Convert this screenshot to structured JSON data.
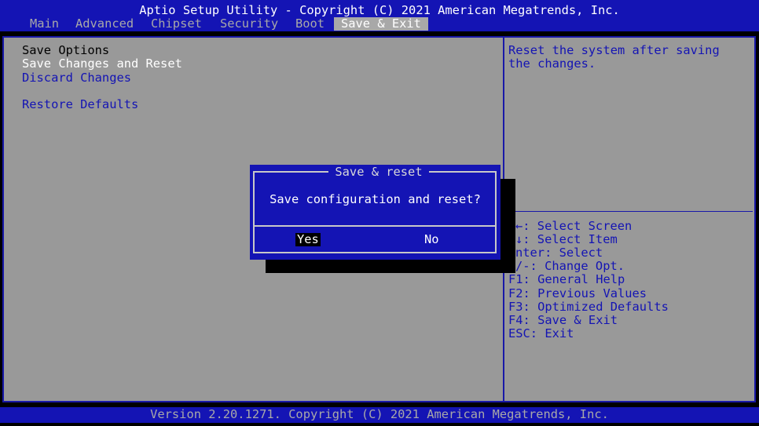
{
  "title": "Aptio Setup Utility - Copyright (C) 2021 American Megatrends, Inc.",
  "tabs": [
    {
      "label": "Main"
    },
    {
      "label": "Advanced"
    },
    {
      "label": "Chipset"
    },
    {
      "label": "Security"
    },
    {
      "label": "Boot"
    },
    {
      "label": "Save & Exit"
    }
  ],
  "active_tab": "Save & Exit",
  "menu": {
    "header": "Save Options",
    "items": [
      "Save Changes and Reset",
      "Discard Changes",
      "Restore Defaults"
    ]
  },
  "help": {
    "line1": "Reset the system after saving",
    "line2": "the changes."
  },
  "keys": [
    "←: Select Screen",
    "↓: Select Item",
    "nter: Select",
    "/-: Change Opt.",
    "F1: General Help",
    "F2: Previous Values",
    "F3: Optimized Defaults",
    "F4: Save & Exit",
    "ESC: Exit"
  ],
  "dialog": {
    "title": "Save & reset",
    "message": "Save configuration and reset?",
    "yes_label": "Yes",
    "no_label": "No"
  },
  "footer": "Version 2.20.1271. Copyright (C) 2021 American Megatrends, Inc.",
  "colors": {
    "bios_blue": "#1414b4",
    "panel_gray": "#999999",
    "text_white": "#ffffff"
  }
}
